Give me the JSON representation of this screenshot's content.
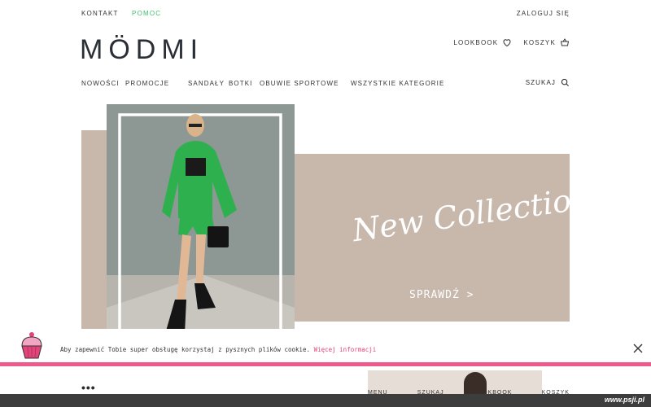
{
  "topbar": {
    "contact": "KONTAKT",
    "help": "POMOC",
    "login": "ZALOGUJ SIĘ"
  },
  "brand": {
    "logo": "MÖDMI"
  },
  "header_actions": {
    "lookbook": "LOOKBOOK",
    "cart": "KOSZYK"
  },
  "nav": {
    "items": [
      "NOWOŚCI",
      "PROMOCJE",
      "SANDAŁY",
      "BOTKI",
      "OBUWIE SPORTOWE",
      "WSZYSTKIE KATEGORIE"
    ],
    "search": "SZUKAJ"
  },
  "hero": {
    "title": "New Collection",
    "cta": "SPRAWDŹ  >"
  },
  "cookie": {
    "text": "Aby zapewnić Tobie super obsługę korzystaj z pysznych plików cookie.",
    "link": "Więcej informacji"
  },
  "below": {
    "dots": "•••",
    "menu": "MENU",
    "search": "SZUKAJ",
    "lookbook": "LOOKBOOK",
    "cart": "KOSZYK"
  },
  "watermark": "www.psji.pl",
  "colors": {
    "accent_green": "#3bbf6a",
    "banner_beige": "#c8b8ac",
    "cookie_pink": "#ee5b8a"
  }
}
